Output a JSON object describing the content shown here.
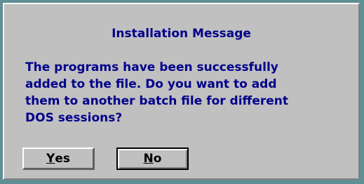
{
  "dialog": {
    "title": "Installation Message",
    "message": "The programs have been successfully\nadded to the file.  Do you want to add\nthem to another batch file for different\nDOS sessions?"
  },
  "buttons": {
    "yes": {
      "hotkey": "Y",
      "rest": "es"
    },
    "no": {
      "hotkey": "N",
      "rest": "o"
    }
  },
  "colors": {
    "background": "#c0c0c0",
    "text": "#00008b",
    "border": "#5f8f95"
  }
}
